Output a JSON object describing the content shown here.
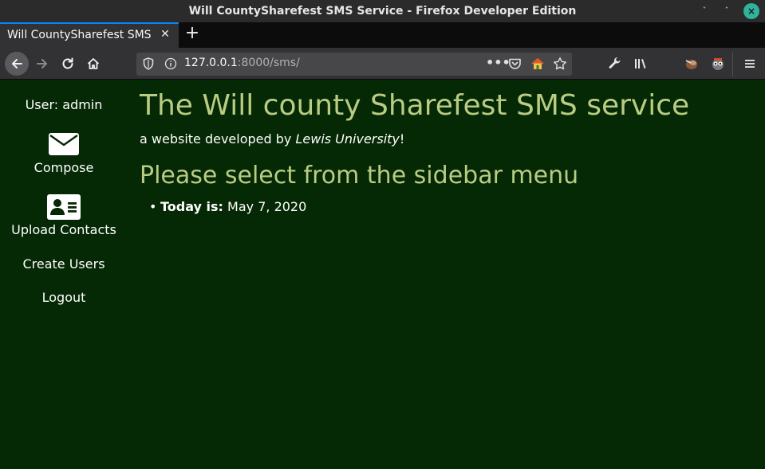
{
  "window": {
    "title": "Will CountySharefest SMS Service - Firefox Developer Edition",
    "minimize_glyph": "ˇ",
    "maximize_glyph": "ˆ",
    "close_glyph": "×"
  },
  "tabs": [
    {
      "label": "Will CountySharefest SMS Service",
      "close_glyph": "✕",
      "active": true
    }
  ],
  "newtab_glyph": "+",
  "navigation": {
    "url_host": "127.0.0.1",
    "url_rest": ":8000/sms/",
    "more_glyph": "•••",
    "icons": [
      "back-icon",
      "forward-icon",
      "reload-icon",
      "home-icon",
      "shield-icon",
      "info-icon",
      "more-icon",
      "pocket-icon",
      "extension-home-icon",
      "star-icon",
      "wrench-icon",
      "library-icon",
      "sidebar-icon",
      "extension-icon",
      "extension-icon",
      "hamburger-menu-icon"
    ]
  },
  "sidebar": {
    "user": "User: admin",
    "compose": "Compose",
    "upload": "Upload Contacts",
    "create_users": "Create Users",
    "logout": "Logout"
  },
  "main": {
    "heading": "The Will county Sharefest SMS service",
    "sub_prefix": "a website developed by ",
    "sub_org": "Lewis University",
    "sub_suffix": "!",
    "subheading": "Please select from the sidebar menu",
    "bullet": "•",
    "today_label": "Today is:",
    "today_value": "May 7, 2020"
  },
  "colors": {
    "page_background": "#052805",
    "heading": "#b9cc82",
    "chrome_dark": "#323234",
    "tab_accent": "#0a84ff",
    "close_button": "#2fb39a"
  }
}
